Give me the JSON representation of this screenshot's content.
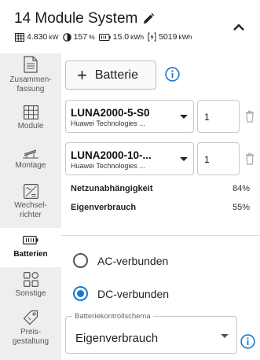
{
  "header": {
    "title": "14 Module System",
    "stats": {
      "power_value": "4.830",
      "power_unit": "kW",
      "ratio_value": "157",
      "ratio_unit": "%",
      "battery_value": "15.0",
      "battery_unit": "kWh",
      "energy_value": "5019",
      "energy_unit": "kWh"
    }
  },
  "sidebar": {
    "items": [
      {
        "label": "Zusammen-\nfassung",
        "icon": "summary-icon"
      },
      {
        "label": "Module",
        "icon": "module-grid-icon"
      },
      {
        "label": "Montage",
        "icon": "mounting-icon"
      },
      {
        "label": "Wechsel-\nrichter",
        "icon": "inverter-icon"
      },
      {
        "label": "Batterien",
        "icon": "battery-icon",
        "active": true
      },
      {
        "label": "Sonstige",
        "icon": "misc-grid-icon"
      },
      {
        "label": "Preis-\ngestaltung",
        "icon": "price-tag-icon"
      }
    ]
  },
  "main": {
    "add_button_label": "Batterie",
    "batteries": [
      {
        "name": "LUNA2000-5-S0",
        "maker": "Huawei Technologies ...",
        "quantity": "1"
      },
      {
        "name": "LUNA2000-10-...",
        "maker": "Huawei Technologies ...",
        "quantity": "1"
      }
    ],
    "metrics": [
      {
        "label": "Netzunabhängigkeit",
        "value": "84%"
      },
      {
        "label": "Eigenverbrauch",
        "value": "55%"
      }
    ],
    "coupling": {
      "options": [
        "AC-verbunden",
        "DC-verbunden"
      ],
      "selected": "DC-verbunden"
    },
    "schema": {
      "legend": "Batteriekontrollschema",
      "value": "Eigenverbrauch"
    }
  },
  "colors": {
    "accent": "#1976d2",
    "sidebar_bg": "#eeeeee"
  }
}
